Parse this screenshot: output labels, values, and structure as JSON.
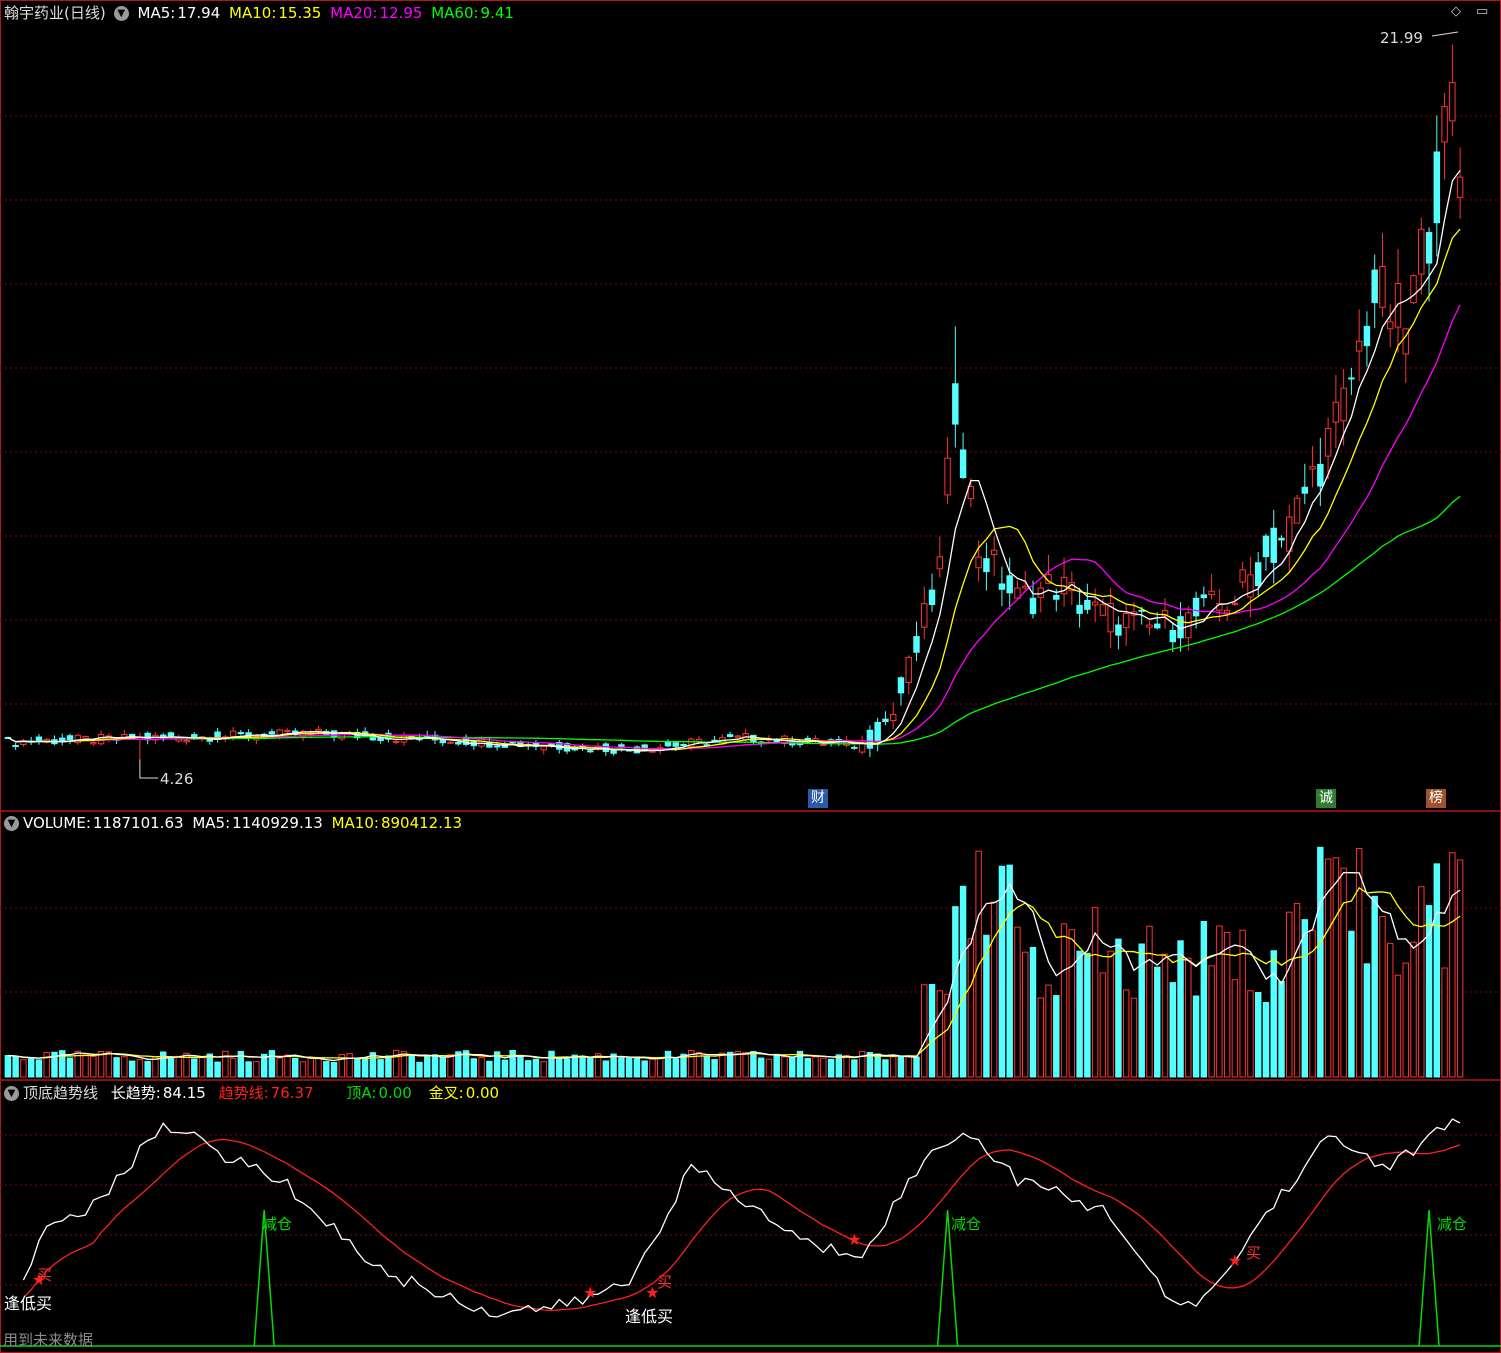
{
  "header": {
    "title": "翰宇药业(日线)",
    "ma5_label": "MA5:",
    "ma5": "17.94",
    "ma10_label": "MA10:",
    "ma10": "15.35",
    "ma20_label": "MA20:",
    "ma20": "12.95",
    "ma60_label": "MA60:",
    "ma60": "9.41"
  },
  "volume_header": {
    "volume_label": "VOLUME:",
    "volume": "1187101.63",
    "ma5_label": "MA5:",
    "ma5": "1140929.13",
    "ma10_label": "MA10:",
    "ma10": "890412.13"
  },
  "indicator_header": {
    "name": "顶底趋势线",
    "long_label": "长趋势:",
    "long": "84.15",
    "trend_label": "趋势线:",
    "trend": "76.37",
    "topA_label": "顶A:",
    "topA": "0.00",
    "cross_label": "金叉:",
    "cross": "0.00"
  },
  "annotations": {
    "high_label": "21.99",
    "low_label": "4.26",
    "markers": [
      "财",
      "诚",
      "榜"
    ],
    "buy": "买",
    "low_buy": "逢低买",
    "reduce": "减仓"
  },
  "corner_icons": [
    "diamond-icon",
    "window-restore-icon"
  ],
  "footer": "用到未来数据",
  "colors": {
    "background": "#000000",
    "up": "#ff3232",
    "down": "#54ffff",
    "ma5": "#ffffff",
    "ma10": "#ffff00",
    "ma20": "#ff00ff",
    "ma60": "#00ff00",
    "grid": "#8b0000",
    "border": "#b01818",
    "trend_red": "#ff2020",
    "signal_green": "#00dd00"
  },
  "chart_data": [
    {
      "type": "candlestick",
      "panel": "price",
      "high": 21.99,
      "low": 4.26,
      "ylim": [
        3.6,
        22.5
      ],
      "phases": [
        {
          "name": "flat",
          "bars": 110,
          "range": [
            4.3,
            5.0
          ]
        },
        {
          "name": "rally",
          "bars": 10,
          "peak": 13.2
        },
        {
          "name": "pullback",
          "bars": 30,
          "low": 7.6
        },
        {
          "name": "breakout",
          "bars": 38,
          "peak": 21.99
        }
      ],
      "ma": {
        "MA5": 17.94,
        "MA10": 15.35,
        "MA20": 12.95,
        "MA60": 9.41
      }
    },
    {
      "type": "bar",
      "panel": "volume",
      "last": 1187101.63,
      "ma5": 1140929.13,
      "ma10": 890412.13
    },
    {
      "type": "line",
      "panel": "indicator",
      "series": [
        {
          "name": "长趋势",
          "last": 84.15
        },
        {
          "name": "趋势线",
          "last": 76.37
        }
      ],
      "ylim": [
        0,
        100
      ]
    }
  ]
}
